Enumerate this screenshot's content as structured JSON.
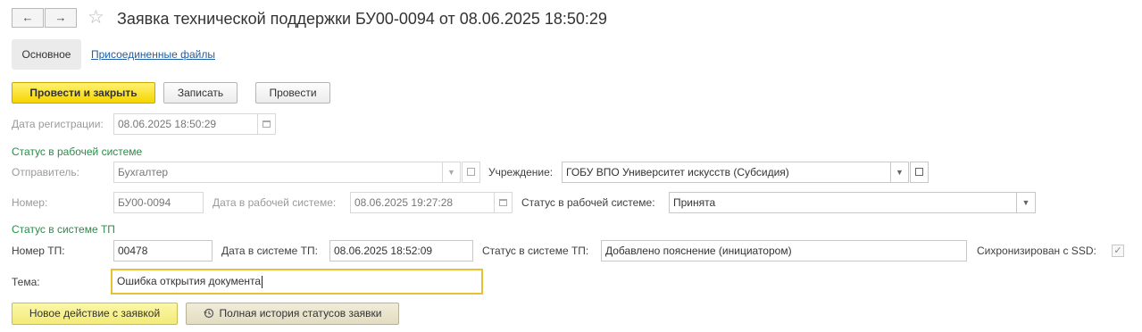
{
  "window": {
    "title": "Заявка технической поддержки БУ00-0094 от 08.06.2025 18:50:29",
    "nav": {
      "back_icon": "←",
      "forward_icon": "→",
      "favorite_icon": "☆"
    }
  },
  "tabs": {
    "main": "Основное",
    "files": "Присоединенные файлы"
  },
  "toolbar": {
    "post_close": "Провести и закрыть",
    "save": "Записать",
    "post": "Провести"
  },
  "registration": {
    "label": "Дата регистрации:",
    "value": "08.06.2025 18:50:29"
  },
  "work_system": {
    "section": "Статус в рабочей системе",
    "sender_label": "Отправитель:",
    "sender_value": "Бухгалтер",
    "institution_label": "Учреждение:",
    "institution_value": "ГОБУ ВПО Университет искусств (Субсидия)",
    "number_label": "Номер:",
    "number_value": "БУ00-0094",
    "date_label": "Дата в рабочей системе:",
    "date_value": "08.06.2025 19:27:28",
    "status_label": "Статус в рабочей системе:",
    "status_value": "Принята"
  },
  "tp_system": {
    "section": "Статус в системе ТП",
    "number_label": "Номер ТП:",
    "number_value": "00478",
    "date_label": "Дата в системе ТП:",
    "date_value": "08.06.2025 18:52:09",
    "status_label": "Статус в системе ТП:",
    "status_value": "Добавлено пояснение (инициатором)",
    "sync_label": "Сихронизирован с SSD:",
    "sync_checked": true
  },
  "topic": {
    "label": "Тема:",
    "value": "Ошибка открытия документа"
  },
  "actions": {
    "new_action": "Новое действие с заявкой",
    "history": "Полная история статусов заявки",
    "history_icon": "history-icon"
  },
  "colors": {
    "primary_button": "#f5d500",
    "section_header": "#2a8c4a",
    "link": "#1f5ea8",
    "focus_border": "#e8c036"
  }
}
